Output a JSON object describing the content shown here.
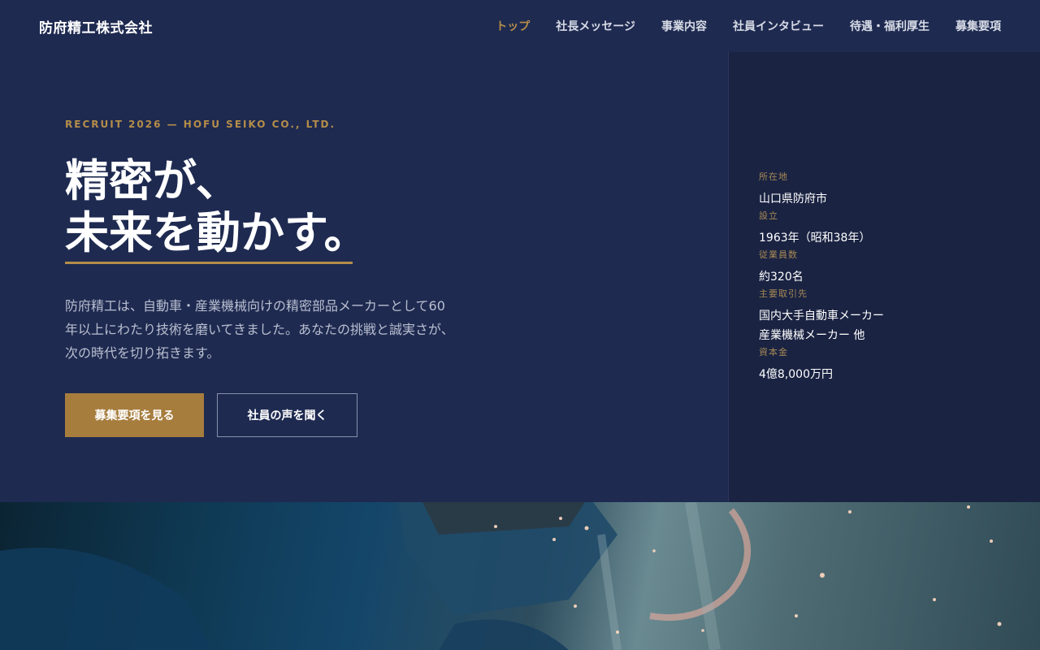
{
  "header": {
    "logo": "防府精工株式会社",
    "nav": [
      {
        "label": "トップ",
        "active": true
      },
      {
        "label": "社長メッセージ",
        "active": false
      },
      {
        "label": "事業内容",
        "active": false
      },
      {
        "label": "社員インタビュー",
        "active": false
      },
      {
        "label": "待遇・福利厚生",
        "active": false
      },
      {
        "label": "募集要項",
        "active": false
      }
    ]
  },
  "hero": {
    "eyebrow": "RECRUIT 2026 — HOFU SEIKO CO., LTD.",
    "headline_line1": "精密が、",
    "headline_line2": "未来を動かす。",
    "lead": "防府精工は、自動車・産業機械向けの精密部品メーカーとして60年以上にわたり技術を磨いてきました。あなたの挑戦と誠実さが、次の時代を切り拓きます。",
    "primary_button": "募集要項を見る",
    "secondary_button": "社員の声を聞く"
  },
  "company_info": [
    {
      "label": "所在地",
      "value": "山口県防府市"
    },
    {
      "label": "設立",
      "value": "1963年（昭和38年）"
    },
    {
      "label": "従業員数",
      "value": "約320名"
    },
    {
      "label": "主要取引先",
      "value": "国内大手自動車メーカー\n産業機械メーカー 他"
    },
    {
      "label": "資本金",
      "value": "4億8,000万円"
    }
  ],
  "colors": {
    "navy": "#1e2a50",
    "panel": "#1a2342",
    "gold": "#b58d4a",
    "button_gold": "#a77d3e"
  }
}
